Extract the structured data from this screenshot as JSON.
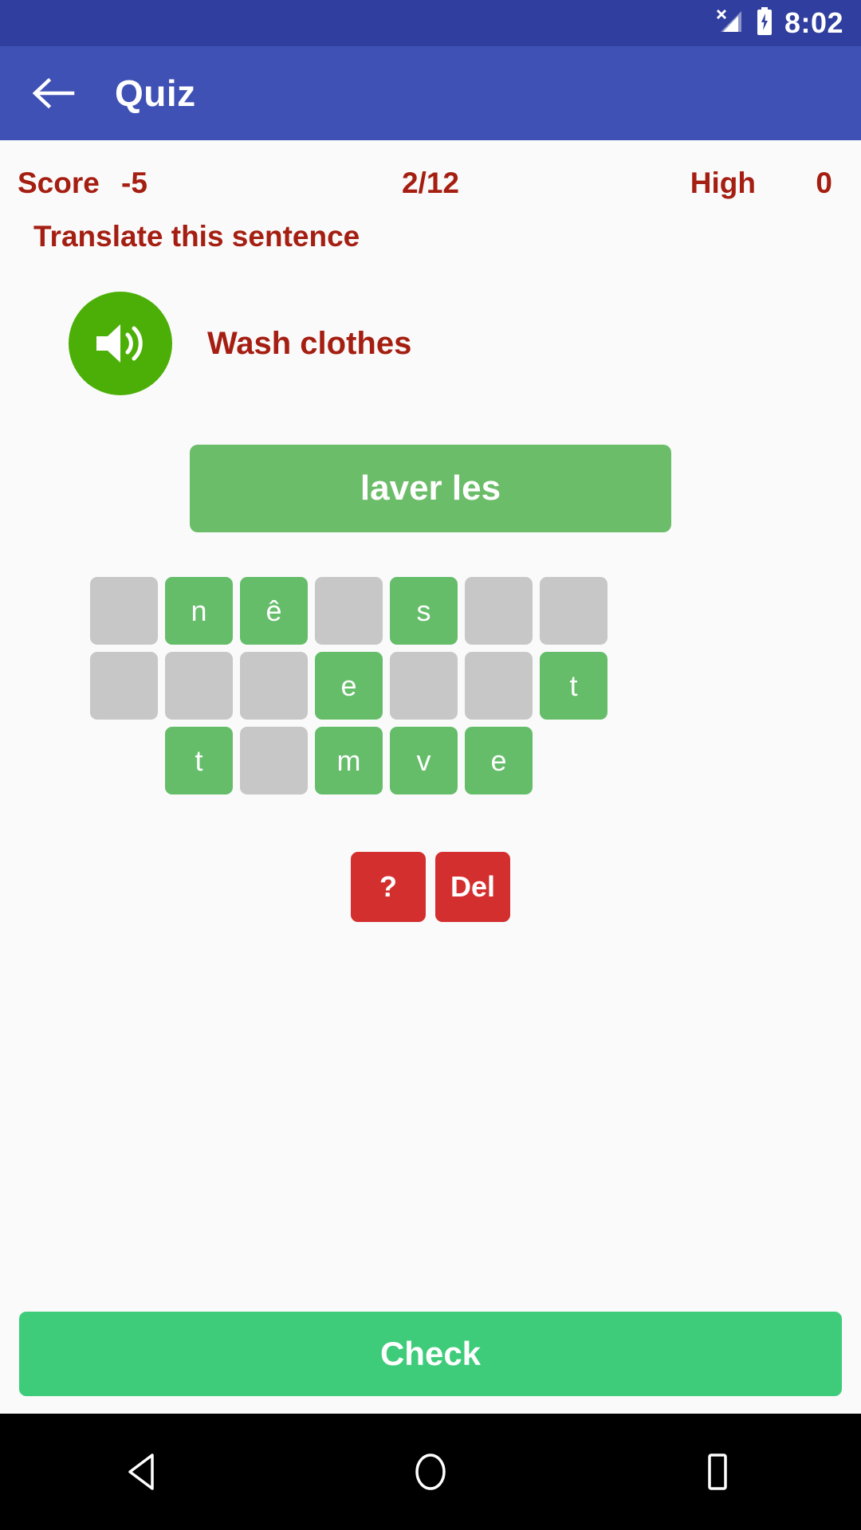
{
  "statusbar": {
    "time": "8:02",
    "signal_icon": "signal-no-service-icon",
    "battery_icon": "battery-charging-icon",
    "bg_color": "#303f9f"
  },
  "appbar": {
    "title": "Quiz",
    "back_icon": "arrow-back-icon",
    "bg_color": "#3f51b5"
  },
  "score": {
    "label": "Score",
    "value": "-5",
    "progress": "2/12",
    "high_label": "High",
    "high_value": "0",
    "color": "#a51e12"
  },
  "quiz": {
    "prompt": "Translate this sentence",
    "speaker_icon": "speaker-volume-icon",
    "speaker_color": "#4caf07",
    "phrase": "Wash clothes",
    "answer": "laver les",
    "answer_color": "#6cbd6a"
  },
  "keyboard": {
    "tile_green": "#65bd6a",
    "tile_gray": "#c7c7c7",
    "rows": [
      [
        {
          "letter": "",
          "state": "gray"
        },
        {
          "letter": "n",
          "state": "green"
        },
        {
          "letter": "ê",
          "state": "green"
        },
        {
          "letter": "",
          "state": "gray"
        },
        {
          "letter": "s",
          "state": "green"
        },
        {
          "letter": "",
          "state": "gray"
        },
        {
          "letter": "",
          "state": "gray"
        }
      ],
      [
        {
          "letter": "",
          "state": "gray"
        },
        {
          "letter": "",
          "state": "gray"
        },
        {
          "letter": "",
          "state": "gray"
        },
        {
          "letter": "e",
          "state": "green"
        },
        {
          "letter": "",
          "state": "gray"
        },
        {
          "letter": "",
          "state": "gray"
        },
        {
          "letter": "t",
          "state": "green"
        }
      ],
      [
        {
          "letter": "",
          "state": "spacer"
        },
        {
          "letter": "t",
          "state": "green"
        },
        {
          "letter": "",
          "state": "gray"
        },
        {
          "letter": "m",
          "state": "green"
        },
        {
          "letter": "v",
          "state": "green"
        },
        {
          "letter": "e",
          "state": "green"
        },
        {
          "letter": "",
          "state": "spacer"
        }
      ]
    ]
  },
  "actions": {
    "hint_label": "?",
    "delete_label": "Del",
    "color": "#d42f2f"
  },
  "check": {
    "label": "Check",
    "color": "#3ecc7b"
  },
  "navbar": {
    "back_icon": "nav-back-triangle-icon",
    "home_icon": "nav-home-circle-icon",
    "recents_icon": "nav-recents-square-icon"
  }
}
